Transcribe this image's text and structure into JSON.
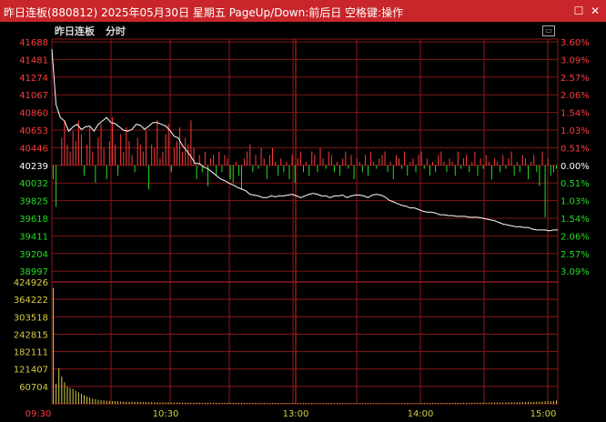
{
  "window": {
    "title": "昨日连板(880812) 2025年05月30日 星期五 PageUp/Down:前后日 空格键:操作",
    "icons": [
      "restore-icon",
      "close-icon"
    ]
  },
  "header": {
    "subtitle": "昨日连板",
    "mode": "分时"
  },
  "colors": {
    "up": "#ff3b3b",
    "down": "#22dd22",
    "flat": "#ffffff",
    "grid": "#8b1a1a",
    "volume": "#d4cc44",
    "title_bar": "#c8262a"
  },
  "chart_data": {
    "type": "line",
    "price_axis": {
      "labels": [
        "41688",
        "41481",
        "41274",
        "41067",
        "40860",
        "40653",
        "40446",
        "40239",
        "40032",
        "39825",
        "39618",
        "39411",
        "39204",
        "38997"
      ],
      "base": "40239"
    },
    "pct_axis": {
      "labels": [
        "3.60%",
        "3.09%",
        "2.57%",
        "2.06%",
        "1.54%",
        "1.03%",
        "0.51%",
        "0.00%",
        "0.51%",
        "1.03%",
        "1.54%",
        "2.06%",
        "2.57%",
        "3.09%"
      ]
    },
    "volume_axis": {
      "labels": [
        "424926",
        "364222",
        "303518",
        "242815",
        "182111",
        "121407",
        "60704"
      ]
    },
    "time_labels": [
      "09:30",
      "10:30",
      "13:00",
      "14:00",
      "15:00"
    ],
    "price_line": [
      [
        0,
        41600
      ],
      [
        2,
        40950
      ],
      [
        4,
        40800
      ],
      [
        6,
        40760
      ],
      [
        8,
        40640
      ],
      [
        10,
        40690
      ],
      [
        12,
        40720
      ],
      [
        14,
        40660
      ],
      [
        16,
        40690
      ],
      [
        18,
        40700
      ],
      [
        20,
        40640
      ],
      [
        22,
        40720
      ],
      [
        24,
        40760
      ],
      [
        26,
        40800
      ],
      [
        28,
        40740
      ],
      [
        30,
        40730
      ],
      [
        32,
        40690
      ],
      [
        34,
        40650
      ],
      [
        36,
        40640
      ],
      [
        38,
        40660
      ],
      [
        40,
        40720
      ],
      [
        42,
        40710
      ],
      [
        44,
        40660
      ],
      [
        46,
        40700
      ],
      [
        48,
        40740
      ],
      [
        50,
        40740
      ],
      [
        52,
        40720
      ],
      [
        54,
        40700
      ],
      [
        56,
        40650
      ],
      [
        58,
        40580
      ],
      [
        60,
        40560
      ],
      [
        62,
        40470
      ],
      [
        64,
        40410
      ],
      [
        66,
        40340
      ],
      [
        68,
        40260
      ],
      [
        70,
        40260
      ],
      [
        72,
        40220
      ],
      [
        74,
        40200
      ],
      [
        76,
        40160
      ],
      [
        78,
        40120
      ],
      [
        80,
        40080
      ],
      [
        82,
        40060
      ],
      [
        84,
        40030
      ],
      [
        86,
        40010
      ],
      [
        88,
        39980
      ],
      [
        90,
        39960
      ],
      [
        92,
        39940
      ],
      [
        94,
        39900
      ],
      [
        96,
        39890
      ],
      [
        98,
        39880
      ],
      [
        100,
        39860
      ],
      [
        102,
        39860
      ],
      [
        104,
        39880
      ],
      [
        106,
        39870
      ],
      [
        108,
        39880
      ],
      [
        110,
        39880
      ],
      [
        112,
        39890
      ],
      [
        114,
        39900
      ],
      [
        116,
        39880
      ],
      [
        118,
        39860
      ],
      [
        120,
        39880
      ],
      [
        122,
        39900
      ],
      [
        124,
        39910
      ],
      [
        126,
        39900
      ],
      [
        128,
        39880
      ],
      [
        130,
        39880
      ],
      [
        132,
        39860
      ],
      [
        134,
        39880
      ],
      [
        136,
        39880
      ],
      [
        138,
        39890
      ],
      [
        140,
        39860
      ],
      [
        142,
        39880
      ],
      [
        144,
        39890
      ],
      [
        146,
        39890
      ],
      [
        148,
        39880
      ],
      [
        150,
        39860
      ],
      [
        152,
        39890
      ],
      [
        154,
        39900
      ],
      [
        156,
        39890
      ],
      [
        158,
        39870
      ],
      [
        160,
        39830
      ],
      [
        162,
        39810
      ],
      [
        164,
        39790
      ],
      [
        166,
        39770
      ],
      [
        168,
        39760
      ],
      [
        170,
        39740
      ],
      [
        172,
        39740
      ],
      [
        174,
        39720
      ],
      [
        176,
        39700
      ],
      [
        178,
        39690
      ],
      [
        180,
        39690
      ],
      [
        182,
        39680
      ],
      [
        184,
        39660
      ],
      [
        186,
        39660
      ],
      [
        188,
        39650
      ],
      [
        190,
        39650
      ],
      [
        192,
        39640
      ],
      [
        194,
        39640
      ],
      [
        196,
        39640
      ],
      [
        198,
        39630
      ],
      [
        200,
        39630
      ],
      [
        202,
        39630
      ],
      [
        204,
        39620
      ],
      [
        206,
        39610
      ],
      [
        208,
        39600
      ],
      [
        210,
        39590
      ],
      [
        212,
        39570
      ],
      [
        214,
        39550
      ],
      [
        216,
        39540
      ],
      [
        218,
        39530
      ],
      [
        220,
        39520
      ],
      [
        222,
        39520
      ],
      [
        224,
        39510
      ],
      [
        226,
        39510
      ],
      [
        228,
        39490
      ],
      [
        230,
        39480
      ],
      [
        232,
        39480
      ],
      [
        234,
        39480
      ],
      [
        236,
        39470
      ],
      [
        238,
        39480
      ],
      [
        240,
        39480
      ]
    ],
    "volume_bars": [
      404000,
      70000,
      125000,
      95000,
      75000,
      60000,
      55000,
      52000,
      45000,
      40000,
      35000,
      30000,
      25000,
      22000,
      18000,
      16000,
      14000,
      13000,
      12000,
      11000,
      10000,
      9500,
      9000,
      8500,
      8000,
      7600,
      7300,
      7000,
      6800,
      6500,
      6300,
      6100,
      6000,
      5800,
      5600,
      5500,
      5300,
      5200,
      5000,
      4900,
      4800,
      4700,
      4600,
      4500,
      4400,
      4300,
      4300,
      4200,
      4200,
      4100,
      4100,
      4000,
      4000,
      3900,
      3900,
      3900,
      3800,
      3800,
      3800,
      3700,
      3700,
      3700,
      3600,
      3600,
      3600,
      3500,
      3500,
      3500,
      3400,
      3400,
      3400,
      3400,
      3300,
      3300,
      3300,
      3300,
      3200,
      3200,
      3200,
      3200,
      3100,
      3100,
      3100,
      3100,
      3000,
      3000,
      3000,
      3000,
      3000,
      2900,
      2900,
      2900,
      2900,
      2900,
      2800,
      2800,
      2800,
      2800,
      2800,
      2800,
      2700,
      2700,
      2700,
      2700,
      2700,
      2700,
      2600,
      2600,
      2600,
      2600,
      2600,
      2600,
      2600,
      2500,
      2500,
      2500,
      2500,
      2500,
      2500,
      2500,
      2600,
      2600,
      2700,
      2700,
      2800,
      2800,
      2800,
      2900,
      2900,
      3000,
      3000,
      3100,
      3100,
      3200,
      3200,
      3300,
      3300,
      3400,
      3400,
      3500,
      3500,
      3600,
      3600,
      3700,
      3700,
      3800,
      3800,
      3900,
      3900,
      4000,
      4000,
      4100,
      4200,
      4300,
      4400,
      4500,
      4600,
      4700,
      4800,
      4900,
      5000,
      5100,
      5200,
      5300,
      5400,
      5500,
      5600,
      5800,
      6000,
      6200,
      6500,
      6800,
      7200,
      7600,
      8000,
      8500,
      9000,
      9500,
      10000,
      11000
    ],
    "strength_bars": [
      -40,
      -120,
      0,
      80,
      130,
      60,
      40,
      100,
      70,
      130,
      90,
      -30,
      60,
      110,
      40,
      -50,
      80,
      120,
      50,
      -40,
      70,
      140,
      60,
      -30,
      90,
      40,
      110,
      70,
      30,
      -20,
      80,
      60,
      40,
      100,
      -70,
      60,
      50,
      130,
      20,
      40,
      90,
      120,
      -20,
      50,
      70,
      110,
      40,
      80,
      60,
      130,
      50,
      -40,
      30,
      -20,
      40,
      -60,
      20,
      30,
      -30,
      40,
      -20,
      30,
      20,
      -40,
      -50,
      10,
      -30,
      -70,
      20,
      40,
      60,
      -20,
      30,
      -10,
      50,
      20,
      -40,
      30,
      50,
      10,
      -30,
      20,
      -20,
      10,
      -40,
      30,
      -50,
      20,
      40,
      -20,
      10,
      -30,
      40,
      30,
      -20,
      50,
      20,
      -10,
      40,
      30,
      -20,
      10,
      -30,
      20,
      40,
      -10,
      30,
      -40,
      20,
      10,
      -20,
      30,
      -30,
      40,
      10,
      -10,
      20,
      30,
      40,
      -20,
      10,
      -40,
      30,
      20,
      -10,
      40,
      -30,
      10,
      20,
      -20,
      30,
      40,
      -10,
      20,
      -30,
      10,
      -20,
      30,
      40,
      10,
      -20,
      20,
      10,
      -30,
      40,
      -10,
      20,
      30,
      -20,
      10,
      40,
      -30,
      20,
      -10,
      30,
      10,
      -40,
      20,
      10,
      -20,
      30,
      -10,
      20,
      40,
      -30,
      10,
      -20,
      30,
      20,
      -40,
      10,
      30,
      -20,
      -60,
      40,
      -150,
      20,
      -30,
      -20,
      -10
    ]
  }
}
